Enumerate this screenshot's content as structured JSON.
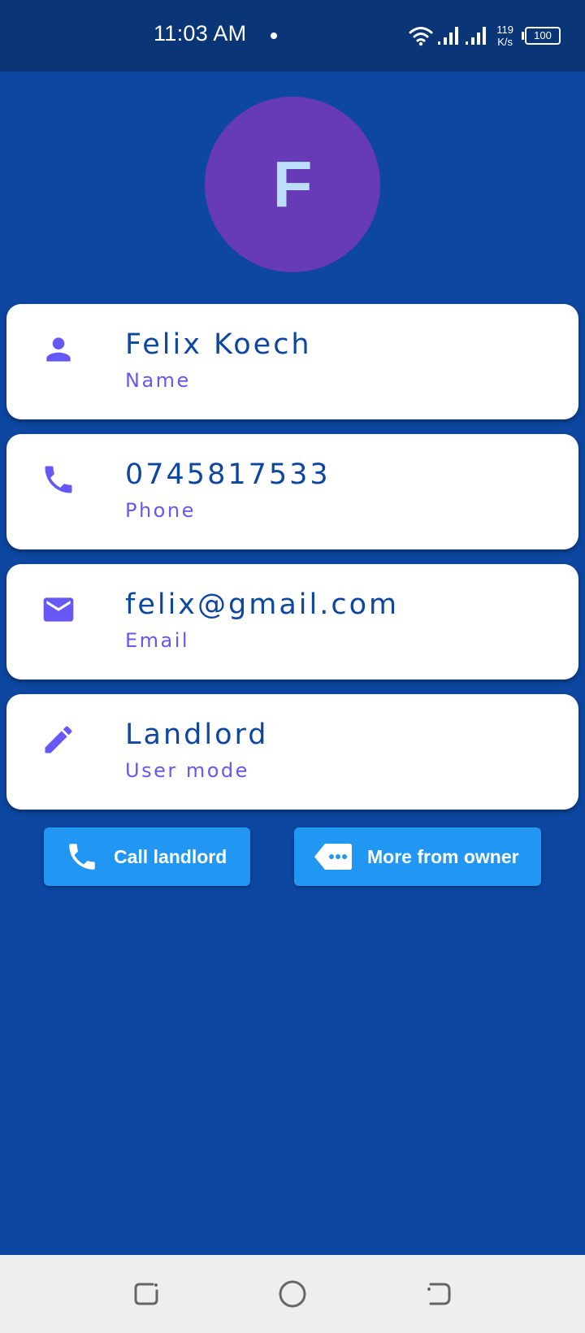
{
  "status_bar": {
    "time": "11:03 AM",
    "net_speed_value": "119",
    "net_speed_unit": "K/s",
    "battery": "100"
  },
  "avatar": {
    "initial": "F"
  },
  "cards": [
    {
      "value": "Felix Koech",
      "label": "Name",
      "icon": "person-icon"
    },
    {
      "value": "0745817533",
      "label": "Phone",
      "icon": "phone-icon"
    },
    {
      "value": "felix@gmail.com",
      "label": "Email",
      "icon": "email-icon"
    },
    {
      "value": "Landlord",
      "label": "User mode",
      "icon": "pencil-icon"
    }
  ],
  "actions": {
    "call_label": "Call landlord",
    "more_label": "More from owner"
  },
  "colors": {
    "background": "#0d47a1",
    "status_bar": "#0a3678",
    "avatar": "#673ab7",
    "avatar_text": "#bbdefb",
    "card_value": "#0d47a1",
    "card_label": "#6558f5",
    "button": "#2196f3",
    "nav_bar": "#eeeeee"
  }
}
